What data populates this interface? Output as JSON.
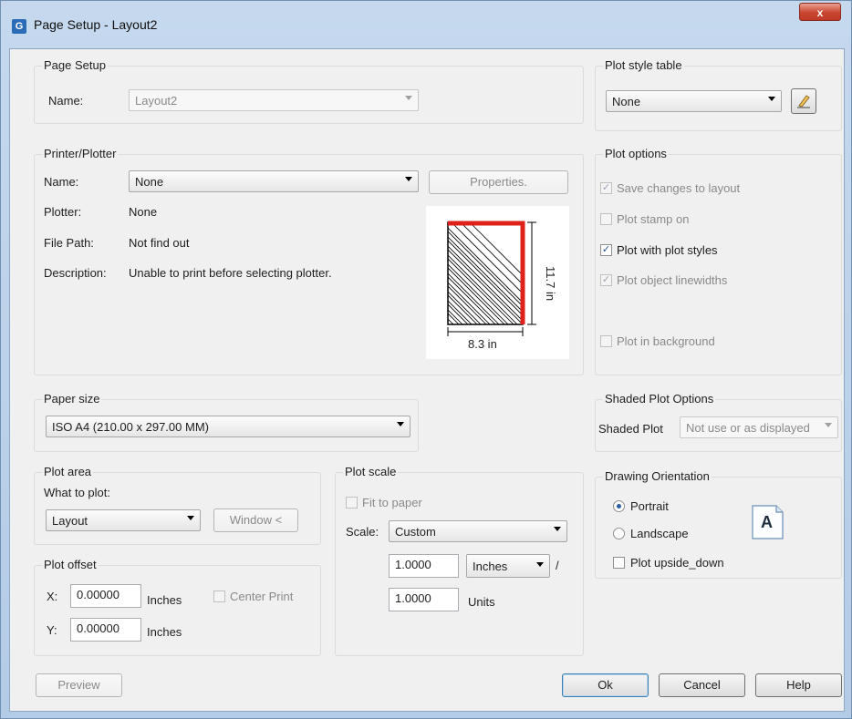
{
  "window": {
    "title": "Page Setup - Layout2",
    "close_label": "x"
  },
  "page_setup": {
    "group_label": "Page Setup",
    "name_label": "Name:",
    "name_value": "Layout2"
  },
  "printer": {
    "group_label": "Printer/Plotter",
    "name_label": "Name:",
    "name_value": "None",
    "properties_label": "Properties.",
    "plotter_label": "Plotter:",
    "plotter_value": "None",
    "filepath_label": "File Path:",
    "filepath_value": "Not find out",
    "description_label": "Description:",
    "description_value": "Unable to print before selecting plotter.",
    "preview": {
      "width_label": "8.3 in",
      "height_label": "11.7 in"
    }
  },
  "paper_size": {
    "group_label": "Paper size",
    "value": "ISO A4 (210.00 x 297.00 MM)"
  },
  "plot_area": {
    "group_label": "Plot area",
    "what_label": "What to plot:",
    "what_value": "Layout",
    "window_label": "Window <"
  },
  "plot_offset": {
    "group_label": "Plot offset",
    "x_label": "X:",
    "x_value": "0.00000",
    "x_unit": "Inches",
    "y_label": "Y:",
    "y_value": "0.00000",
    "y_unit": "Inches",
    "center_label": "Center Print",
    "center_checked": false
  },
  "plot_scale": {
    "group_label": "Plot scale",
    "fit_label": "Fit to paper",
    "fit_checked": false,
    "scale_label": "Scale:",
    "scale_value": "Custom",
    "value1": "1.0000",
    "unit1": "Inches",
    "slash": "/",
    "value2": "1.0000",
    "unit2": "Units"
  },
  "plot_style_table": {
    "group_label": "Plot style table",
    "value": "None",
    "edit_icon": "pencil-edit-icon"
  },
  "plot_options": {
    "group_label": "Plot options",
    "items": [
      {
        "label": "Save changes to layout",
        "checked": true,
        "enabled": false
      },
      {
        "label": "Plot stamp on",
        "checked": false,
        "enabled": false
      },
      {
        "label": "Plot with plot styles",
        "checked": true,
        "enabled": true
      },
      {
        "label": "Plot object linewidths",
        "checked": true,
        "enabled": false
      },
      {
        "label": "Plot in background",
        "checked": false,
        "enabled": false
      }
    ]
  },
  "shaded": {
    "group_label": "Shaded Plot Options",
    "label": "Shaded Plot",
    "value": "Not use or as displayed"
  },
  "orientation": {
    "group_label": "Drawing Orientation",
    "portrait_label": "Portrait",
    "portrait_selected": true,
    "landscape_label": "Landscape",
    "landscape_selected": false,
    "upside_label": "Plot upside_down",
    "upside_checked": false,
    "icon_letter": "A"
  },
  "buttons": {
    "preview": "Preview",
    "ok": "Ok",
    "cancel": "Cancel",
    "help": "Help"
  },
  "colors": {
    "accent_red": "#e0201a",
    "title_bar": "#c5d8ee",
    "dialog_bg": "#f0f0f0"
  }
}
